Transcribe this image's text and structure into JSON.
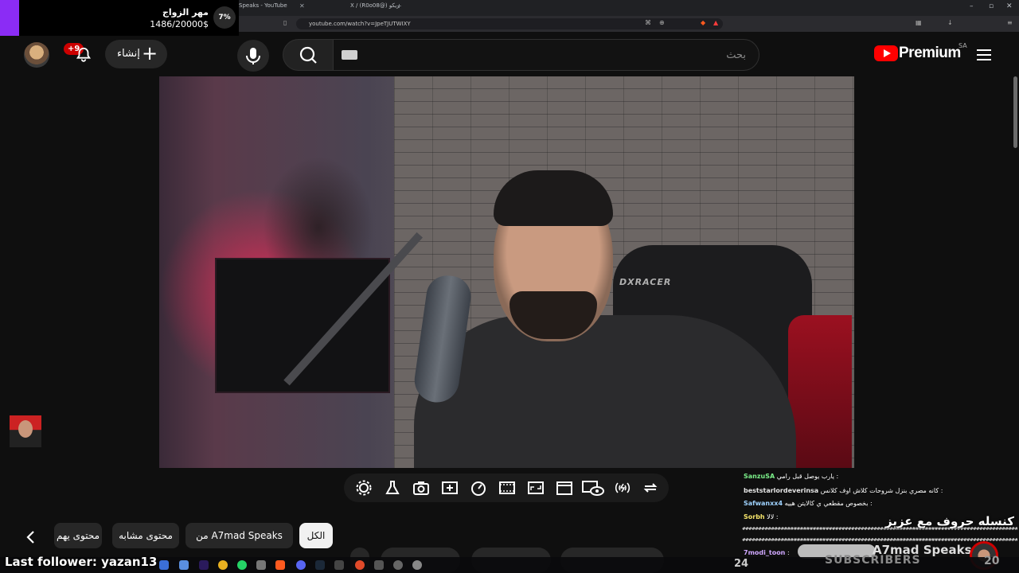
{
  "browser": {
    "tab1_title": "Speaks - YouTube",
    "tab2_title": "X / (R0o08@) ريكو",
    "url": "youtube.com/watch?v=JpeTJUTWIXY"
  },
  "goal_overlay": {
    "title": "مهر الزواج",
    "amount": "1486/20000$",
    "percent": "7%",
    "accent_color": "#8b2cf5"
  },
  "header": {
    "notification_count": "+9",
    "create_label": "إنشاء",
    "search_placeholder": "بحث",
    "logo_text": "Premium",
    "logo_region": "SA",
    "brand_color": "#ff0000"
  },
  "controls": {
    "icons": [
      "gear-icon",
      "flask-icon",
      "camera-icon",
      "sparkle-frame-icon",
      "speedometer-icon",
      "filmstrip-icon",
      "aspect-ratio-icon",
      "clapperboard-icon",
      "eye-screen-icon",
      "broadcast-icon",
      "loop-icon"
    ]
  },
  "chips": {
    "all": "الكل",
    "from_channel": "من A7mad Speaks",
    "similar": "محتوى مشابه",
    "partial": "محتوى يهم"
  },
  "chat": {
    "messages": [
      {
        "user": "SanzuSA",
        "text": "يارب يوصل قبل رامي :"
      },
      {
        "user": "beststarlordeverinsa",
        "text": "كانه مصري بنزل شروحات كلاش اوف كلانس :"
      },
      {
        "user": "Safwanxx4",
        "text": "بخصوص مقطعي ي كالايتن هييه :"
      },
      {
        "user": "Sorbh",
        "text": "لالا :"
      },
      {
        "user": "7modi_toon",
        "text": ":"
      }
    ],
    "banner_title": "كنسله حروف مع عزيز",
    "channel_name": "A7mad Speaks",
    "subscribers_label": "SUBSCRIBERS",
    "subscribers_count": "20",
    "side_count": "24"
  },
  "overlay": {
    "last_follower": "Last follower: yazan13"
  }
}
